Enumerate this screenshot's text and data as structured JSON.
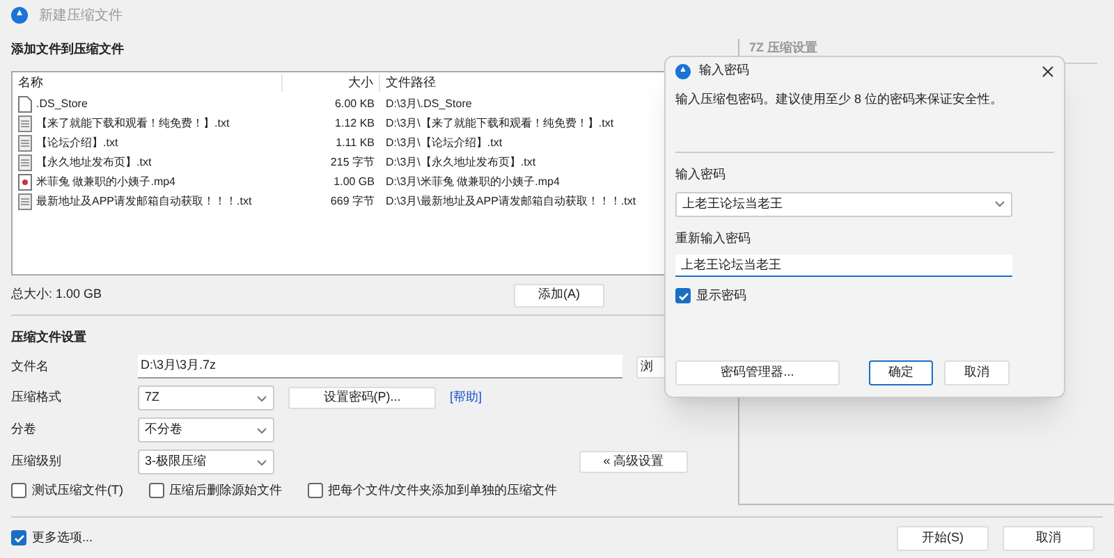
{
  "window": {
    "title": "新建压缩文件"
  },
  "files_section": {
    "title": "添加文件到压缩文件",
    "columns": [
      "名称",
      "大小",
      "文件路径"
    ],
    "rows": [
      {
        "kind": "blank",
        "name": ".DS_Store",
        "size": "6.00 KB",
        "path": "D:\\3月\\.DS_Store"
      },
      {
        "kind": "text",
        "name": "【来了就能下载和观看！纯免费！】.txt",
        "size": "1.12 KB",
        "path": "D:\\3月\\【来了就能下载和观看！纯免费！】.txt"
      },
      {
        "kind": "text",
        "name": "【论坛介绍】.txt",
        "size": "1.11 KB",
        "path": "D:\\3月\\【论坛介绍】.txt"
      },
      {
        "kind": "text",
        "name": "【永久地址发布页】.txt",
        "size": "215 字节",
        "path": "D:\\3月\\【永久地址发布页】.txt"
      },
      {
        "kind": "video",
        "name": "米菲兔  做兼职的小姨子.mp4",
        "size": "1.00 GB",
        "path": "D:\\3月\\米菲兔  做兼职的小姨子.mp4"
      },
      {
        "kind": "text",
        "name": "最新地址及APP请发邮箱自动获取！！！.txt",
        "size": "669 字节",
        "path": "D:\\3月\\最新地址及APP请发邮箱自动获取！！！.txt"
      }
    ],
    "total": "总大小: 1.00 GB",
    "add_button": "添加(A)"
  },
  "settings": {
    "title": "压缩文件设置",
    "filename_label": "文件名",
    "filename": "D:\\3月\\3月.7z",
    "browse_button": "浏",
    "format_label": "压缩格式",
    "format": "7Z",
    "password_button": "设置密码(P)...",
    "help_link": "[帮助]",
    "split_label": "分卷",
    "split": "不分卷",
    "level_label": "压缩级别",
    "level_value": "3-极限压缩",
    "advanced_button": "« 高级设置",
    "checkboxes": [
      {
        "label": "测试压缩文件(T)",
        "checked": false
      },
      {
        "label": "压缩后删除源始文件",
        "checked": false
      },
      {
        "label": "把每个文件/文件夹添加到单独的压缩文件",
        "checked": false
      }
    ]
  },
  "right_panel": {
    "title": "7Z 压缩设置"
  },
  "more_options": {
    "label": "更多选项...",
    "checked": true
  },
  "footer_buttons": [
    "开始(S)",
    "取消"
  ],
  "dialog": {
    "title": "输入密码",
    "message": "输入压缩包密码。建议使用至少 8 位的密码来保证安全性。",
    "password_label": "输入密码",
    "password": "上老王论坛当老王",
    "confirm_label": "重新输入密码",
    "confirm": "上老王论坛当老王",
    "show_password": {
      "label": "显示密码",
      "checked": true
    },
    "manager_button": "密码管理器...",
    "ok_button": "确定",
    "cancel_button": "取消"
  }
}
